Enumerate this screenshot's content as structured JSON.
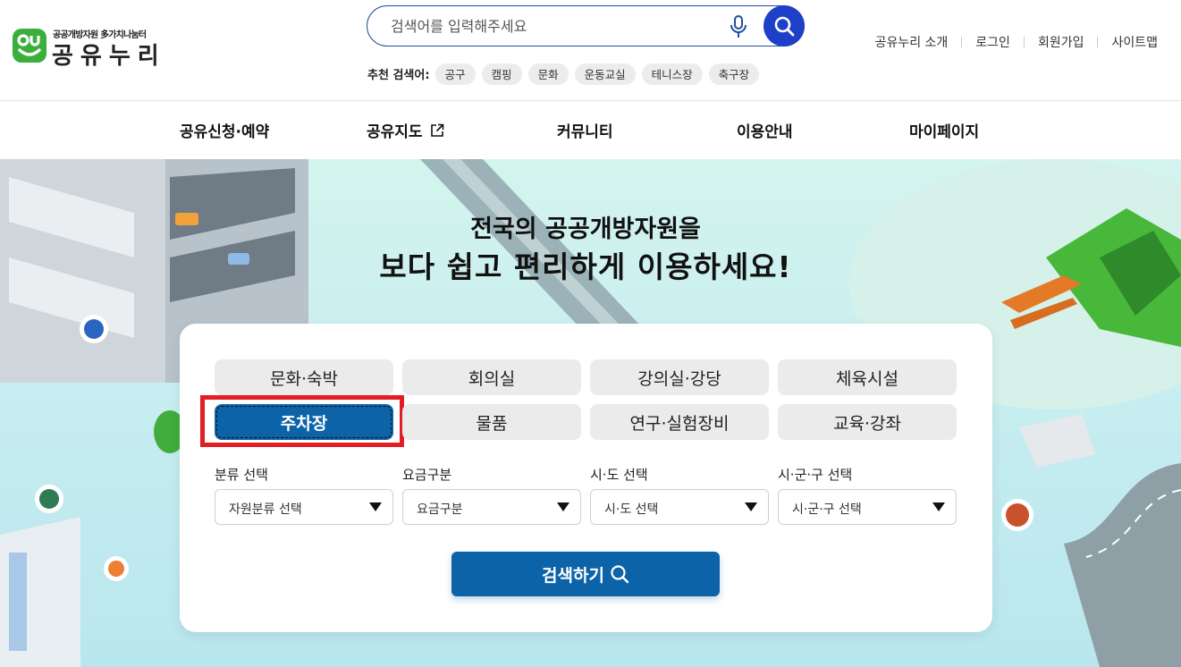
{
  "logo": {
    "sub_text": "공공개방자원 多가치나눔터",
    "main_text": "공유누리",
    "mark_text": "OU"
  },
  "search": {
    "placeholder": "검색어를 입력해주세요",
    "mic_icon": "microphone-icon",
    "button_icon": "search-icon"
  },
  "recommend": {
    "label": "추천 검색어:",
    "chips": [
      "공구",
      "캠핑",
      "문화",
      "운동교실",
      "테니스장",
      "축구장"
    ]
  },
  "util_nav": [
    "공유누리 소개",
    "로그인",
    "회원가입",
    "사이트맵"
  ],
  "gnb": [
    {
      "label": "공유신청·예약"
    },
    {
      "label": "공유지도",
      "icon": "external-link-icon"
    },
    {
      "label": "커뮤니티"
    },
    {
      "label": "이용안내"
    },
    {
      "label": "마이페이지"
    }
  ],
  "hero": {
    "line1": "전국의 공공개방자원을",
    "line2": "보다 쉽고 편리하게 이용하세요!"
  },
  "categories": [
    {
      "label": "문화·숙박",
      "active": false
    },
    {
      "label": "회의실",
      "active": false
    },
    {
      "label": "강의실·강당",
      "active": false
    },
    {
      "label": "체육시설",
      "active": false
    },
    {
      "label": "주차장",
      "active": true
    },
    {
      "label": "물품",
      "active": false
    },
    {
      "label": "연구·실험장비",
      "active": false
    },
    {
      "label": "교육·강좌",
      "active": false
    }
  ],
  "filters": [
    {
      "label": "분류 선택",
      "selected": "자원분류 선택"
    },
    {
      "label": "요금구분",
      "selected": "요금구분"
    },
    {
      "label": "시·도 선택",
      "selected": "시·도 선택"
    },
    {
      "label": "시·군·구 선택",
      "selected": "시·군·구 선택"
    }
  ],
  "submit": {
    "label": "검색하기"
  },
  "colors": {
    "primary": "#0d63a8",
    "search_button": "#1e40c8",
    "highlight_border": "#e31d24",
    "logo_green": "#3cae3c"
  }
}
